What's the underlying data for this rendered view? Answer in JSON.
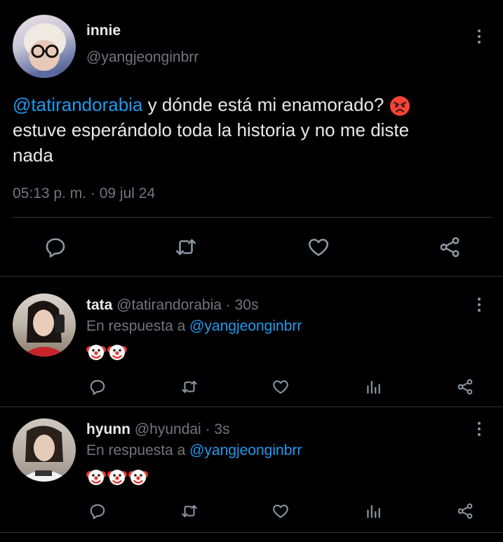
{
  "main_tweet": {
    "display_name": "innie",
    "handle": "@yangjeonginbrr",
    "mention": "@tatirandorabia",
    "text_line1": " y dónde está mi enamorado?",
    "text_line2": "estuve esperándolo toda la historia y no me diste",
    "text_line3": "nada",
    "emoji": "angry-face-emoji",
    "timestamp": "05:13 p. m. · 09 jul 24"
  },
  "replies": [
    {
      "display_name": "tata",
      "handle": "@tatirandorabia",
      "time": "· 30s",
      "reply_prefix": "En respuesta a",
      "reply_to": "@yangjeonginbrr",
      "emoji_count": 2,
      "emoji": "clown-face-emoji"
    },
    {
      "display_name": "hyunn",
      "handle": "@hyundai",
      "time": "· 3s",
      "reply_prefix": "En respuesta a",
      "reply_to": "@yangjeonginbrr",
      "emoji_count": 3,
      "emoji": "clown-face-emoji"
    }
  ],
  "colors": {
    "background": "#000000",
    "link": "#1d9bf0",
    "muted": "#71767b",
    "divider": "#2f3336",
    "icon": "#8b98a5"
  },
  "icons": [
    "more-vertical-icon",
    "reply-icon",
    "retweet-icon",
    "like-icon",
    "analytics-icon",
    "share-icon"
  ]
}
